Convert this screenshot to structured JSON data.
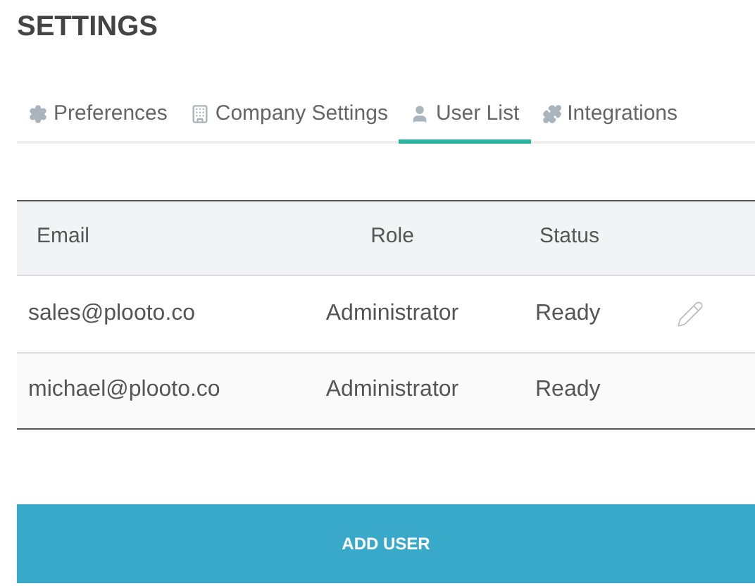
{
  "title": "SETTINGS",
  "tabs": [
    {
      "label": "Preferences",
      "selected": false
    },
    {
      "label": "Company Settings",
      "selected": false
    },
    {
      "label": "User List",
      "selected": true
    },
    {
      "label": "Integrations",
      "selected": false
    }
  ],
  "table": {
    "columns": [
      "Email",
      "Role",
      "Status"
    ],
    "rows": [
      {
        "email": "sales@plooto.co",
        "role": "Administrator",
        "status": "Ready",
        "editable": true
      },
      {
        "email": "michael@plooto.co",
        "role": "Administrator",
        "status": "Ready",
        "editable": false
      }
    ]
  },
  "add_button": "ADD USER"
}
